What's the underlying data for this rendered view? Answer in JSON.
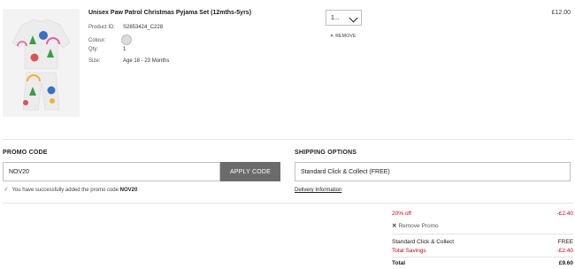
{
  "product": {
    "title": "Unisex Paw Patrol Christmas Pyjama Set (12mths-5yrs)",
    "id_label": "Product ID:",
    "id_value": "S2853424_C228",
    "colour_label": "Colour:",
    "qty_label": "Qty:",
    "qty_value": "1",
    "size_label": "Size:",
    "size_value": "Age 18 - 23 Months",
    "qty_select_value": "1...",
    "remove_label": "REMOVE",
    "price": "£12.00",
    "image_icon": "pyjama-product-image"
  },
  "promo": {
    "heading": "PROMO CODE",
    "input_value": "NOV20",
    "apply_label": "APPLY CODE",
    "success_text": "You have successfully added the promo code",
    "success_code": "NOV20"
  },
  "shipping": {
    "heading": "SHIPPING OPTIONS",
    "selected_option": "Standard Click & Collect (FREE)",
    "delivery_link": "Delivery Information"
  },
  "summary": {
    "discount_label": "20% off",
    "discount_value": "-£2.40",
    "remove_promo_label": "Remove Promo",
    "shipping_label": "Standard Click & Collect",
    "shipping_value": "FREE",
    "savings_label": "Total Savings",
    "savings_value": "-£2.40",
    "total_label": "Total",
    "total_value": "£9.60"
  },
  "colors": {
    "accent_red": "#d0021b",
    "button_grey": "#6b6b6b",
    "success_green": "#4a9e3f"
  }
}
